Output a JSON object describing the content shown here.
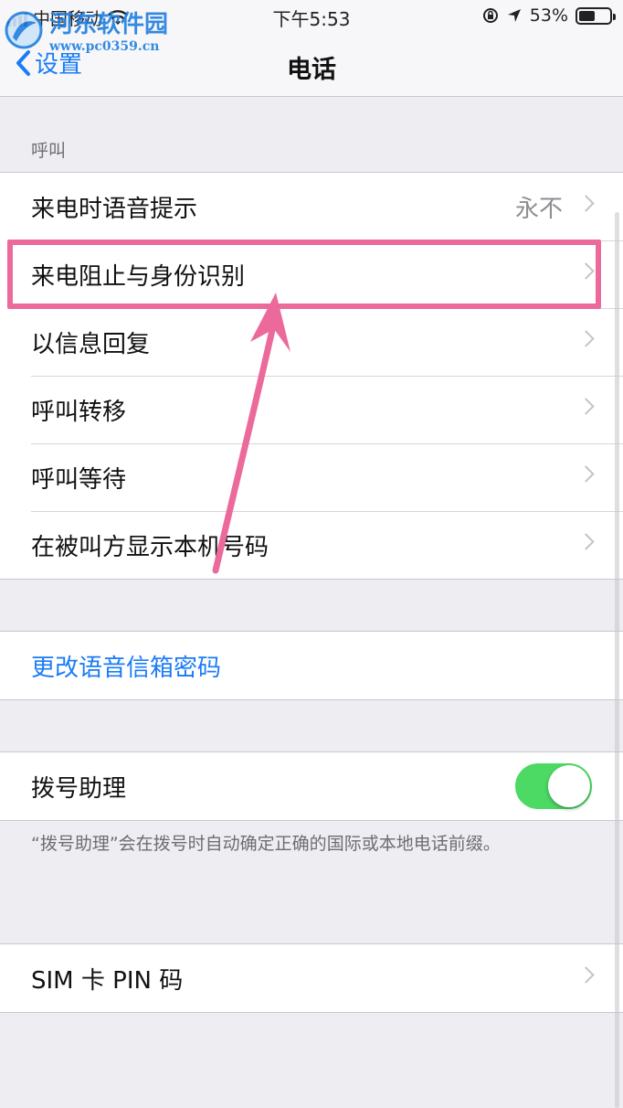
{
  "status": {
    "carrier": "中国移动",
    "time": "下午5:53",
    "battery_pct": "53%",
    "battery_level": 0.53
  },
  "watermark": {
    "title": "河东软件园",
    "url": "www.pc0359.cn"
  },
  "nav": {
    "back_label": "设置",
    "title": "电话"
  },
  "call_section": {
    "header": "呼叫",
    "rows": [
      {
        "label": "来电时语音提示",
        "value": "永不"
      },
      {
        "label": "来电阻止与身份识别"
      },
      {
        "label": "以信息回复"
      },
      {
        "label": "呼叫转移"
      },
      {
        "label": "呼叫等待"
      },
      {
        "label": "在被叫方显示本机号码"
      }
    ]
  },
  "voicemail": {
    "label": "更改语音信箱密码"
  },
  "dial_assist": {
    "label": "拨号助理",
    "enabled": true,
    "note": "“拨号助理”会在拨号时自动确定正确的国际或本地电话前缀。"
  },
  "sim": {
    "label": "SIM 卡 PIN 码"
  },
  "colors": {
    "accent": "#1a7cf5",
    "toggle_on": "#4cd964",
    "annotation": "#ec6a9b"
  }
}
